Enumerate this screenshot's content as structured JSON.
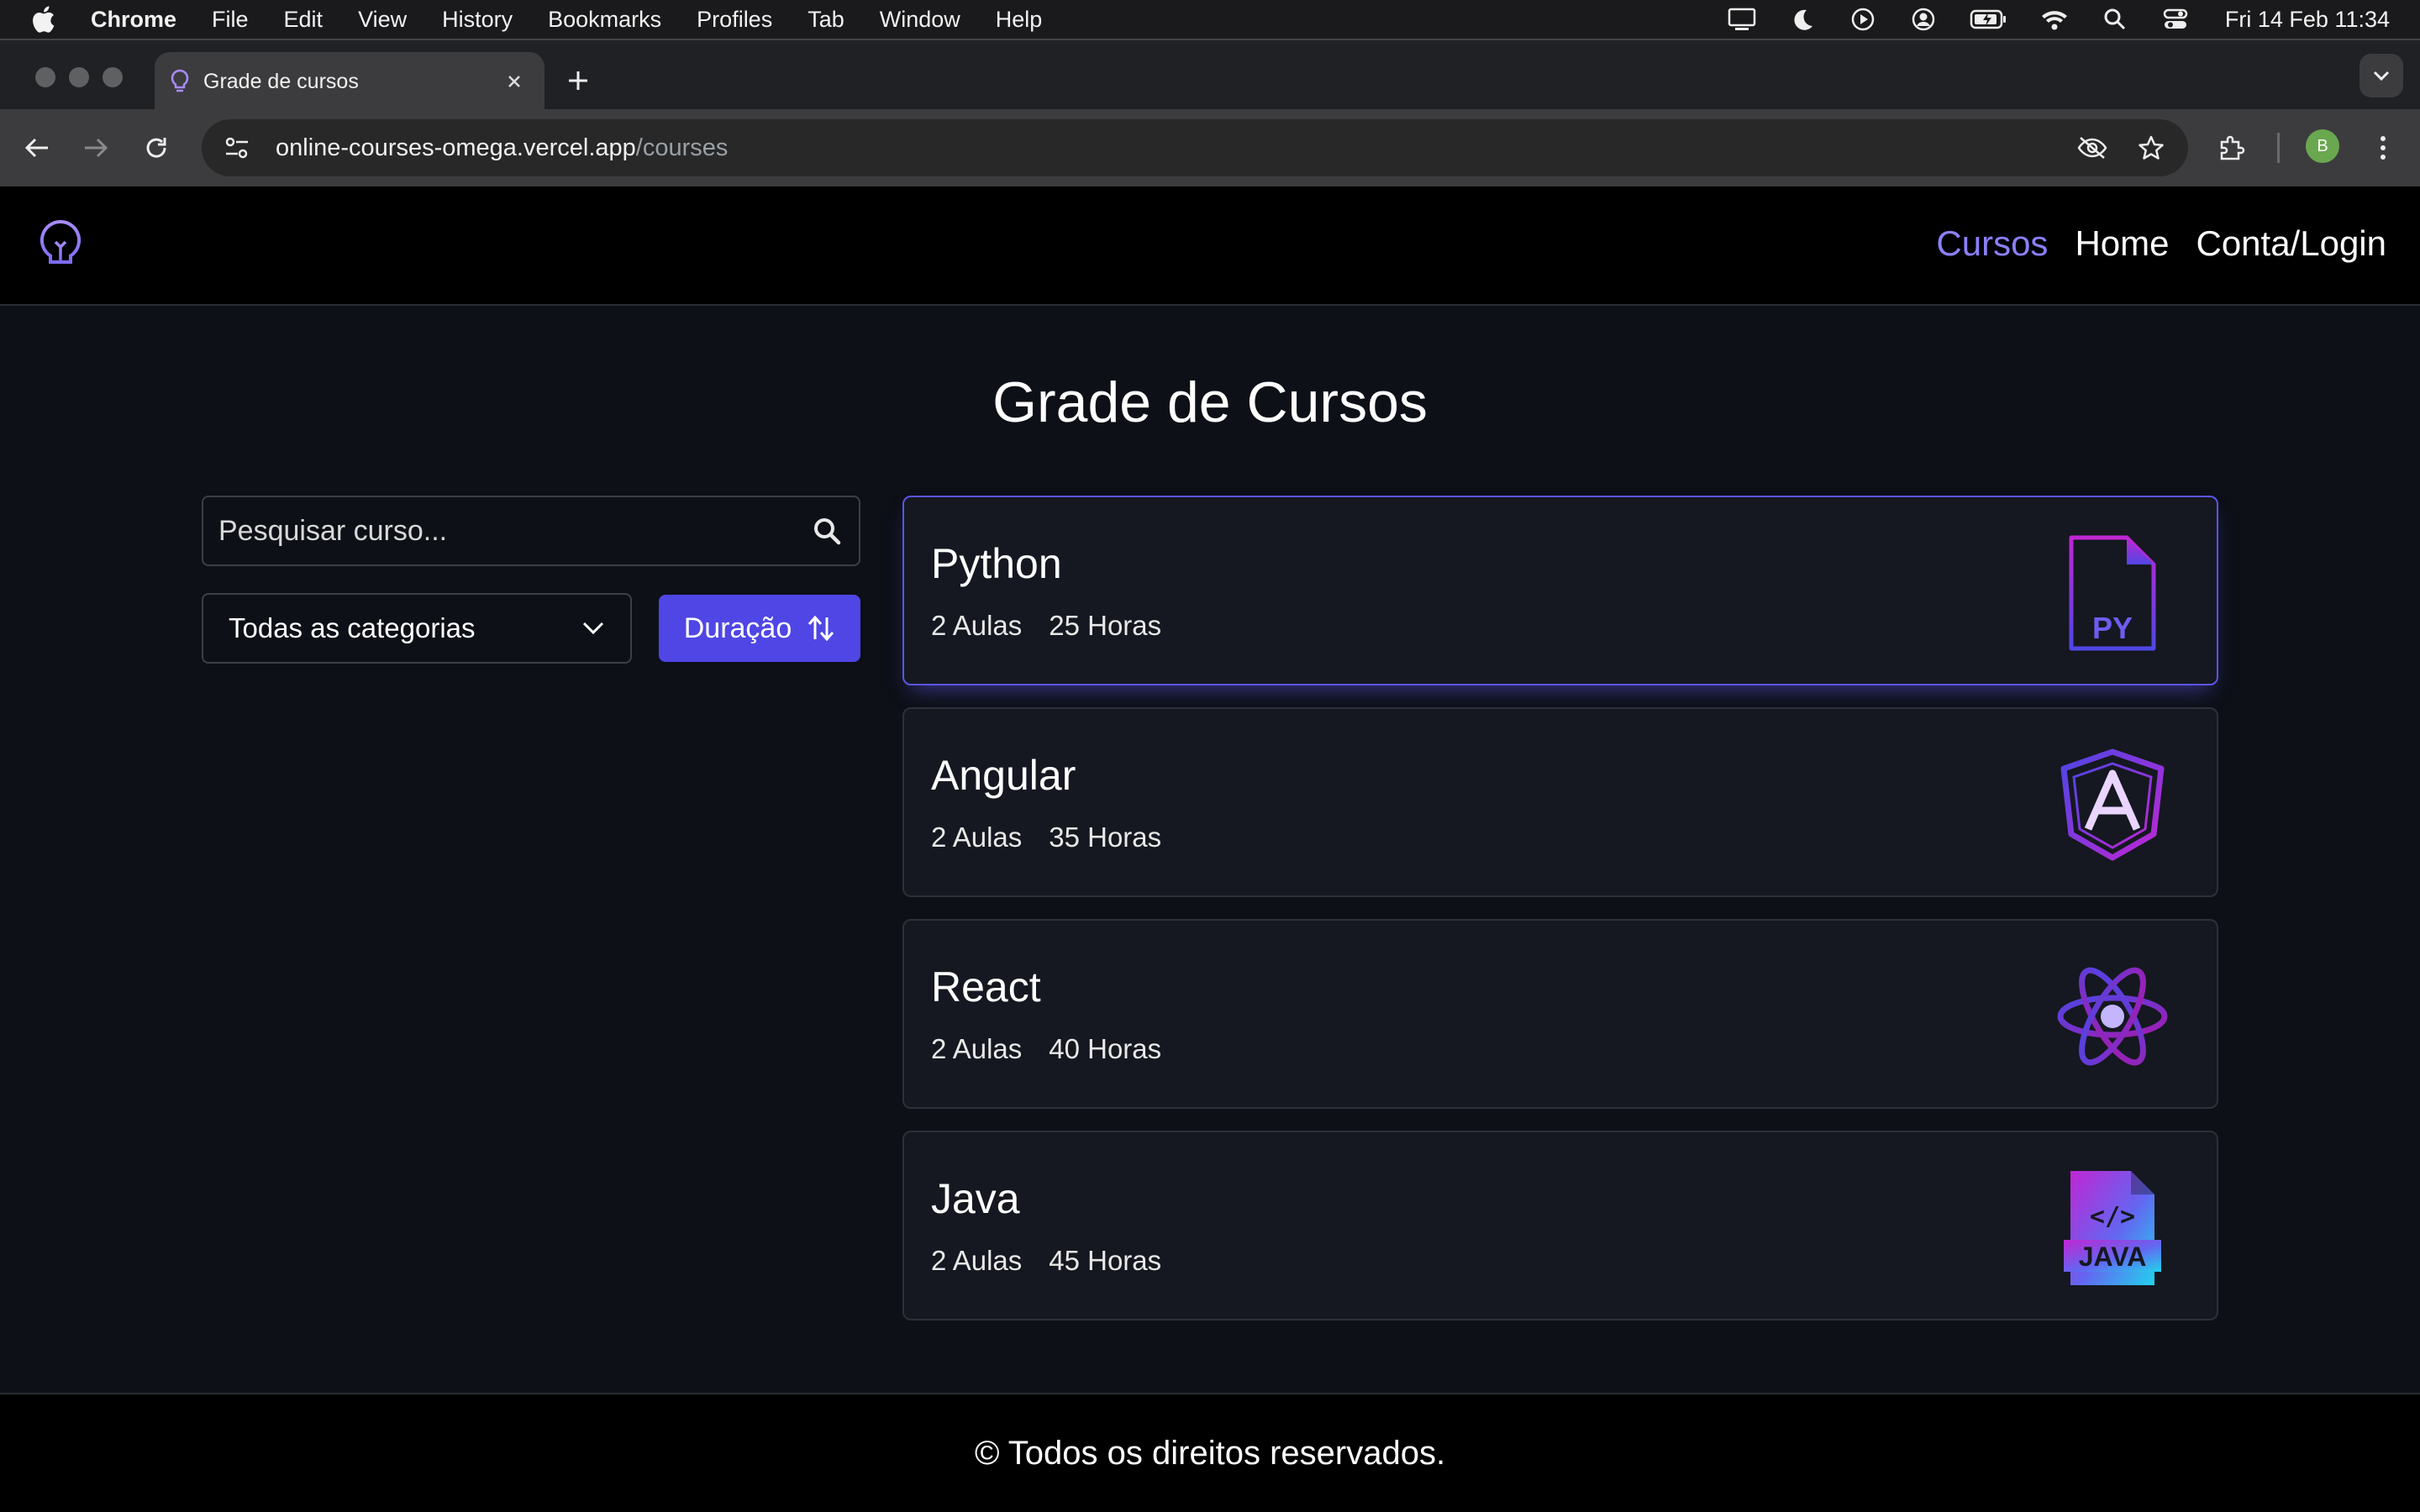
{
  "menubar": {
    "app": "Chrome",
    "items": [
      "File",
      "Edit",
      "View",
      "History",
      "Bookmarks",
      "Profiles",
      "Tab",
      "Window",
      "Help"
    ],
    "clock": "Fri 14 Feb  11:34"
  },
  "browser": {
    "tab_title": "Grade de cursos",
    "url_host": "online-courses-omega.vercel.app",
    "url_path": "/courses",
    "profile_initial": "B"
  },
  "nav": {
    "courses": "Cursos",
    "home": "Home",
    "account": "Conta/Login"
  },
  "page": {
    "title": "Grade de Cursos"
  },
  "filters": {
    "search_placeholder": "Pesquisar curso...",
    "category_selected": "Todas as categorias",
    "sort_label": "Duração"
  },
  "courses": [
    {
      "name": "Python",
      "lessons": "2 Aulas",
      "hours": "25 Horas",
      "icon": "python-file-icon"
    },
    {
      "name": "Angular",
      "lessons": "2 Aulas",
      "hours": "35 Horas",
      "icon": "angular-icon"
    },
    {
      "name": "React",
      "lessons": "2 Aulas",
      "hours": "40 Horas",
      "icon": "react-icon"
    },
    {
      "name": "Java",
      "lessons": "2 Aulas",
      "hours": "45 Horas",
      "icon": "java-file-icon"
    }
  ],
  "footer": {
    "text": "© Todos os direitos reservados."
  },
  "colors": {
    "accent": "#4f46e5",
    "nav_active": "#8b80f9",
    "page_bg": "#0d1017",
    "card_bg": "#151820"
  }
}
